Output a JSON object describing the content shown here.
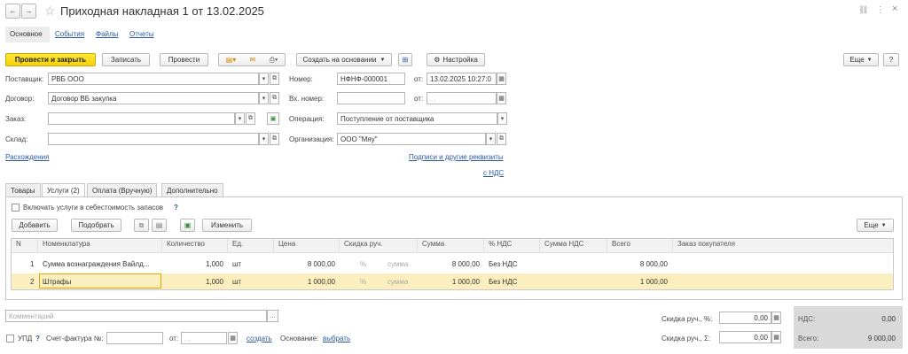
{
  "header": {
    "title": "Приходная накладная 1 от 13.02.2025",
    "back": "←",
    "forward": "→",
    "star": "☆",
    "link_icon": "🔗",
    "more": "⋮",
    "close": "×"
  },
  "nav": [
    "Основное",
    "События",
    "Файлы",
    "Отчеты"
  ],
  "toolbar": {
    "post_close": "Провести и закрыть",
    "save": "Записать",
    "post": "Провести",
    "create_based": "Создать на основании",
    "settings": "Настройка",
    "more": "Еще",
    "help": "?"
  },
  "form": {
    "supplier_label": "Поставщик:",
    "supplier": "РВБ ООО",
    "contract_label": "Договор:",
    "contract": "Договор ВБ закупка",
    "order_label": "Заказ:",
    "order": "",
    "warehouse_label": "Склад:",
    "warehouse": "",
    "number_label": "Номер:",
    "number": "НФНФ-000001",
    "from_label": "от:",
    "date": "13.02.2025 10:27:0",
    "in_number_label": "Вх. номер:",
    "in_number": "",
    "in_from_label": "от:",
    "in_date": " .  .",
    "operation_label": "Операция:",
    "operation": "Поступление от поставщика",
    "org_label": "Организация:",
    "org": "ООО \"Мяу\"",
    "discrepancies": "Расхождения",
    "signatures": "Подписи и другие реквизиты",
    "vat": "с НДС"
  },
  "tabs": [
    "Товары",
    "Услуги (2)",
    "Оплата (Вручную)",
    "Дополнительно"
  ],
  "services": {
    "include_cost_label": "Включать услуги в себестоимость запасов",
    "help": "?",
    "add": "Добавить",
    "pick": "Подобрать",
    "change": "Изменить",
    "more": "Еще",
    "columns": [
      "N",
      "Номенклатура",
      "Количество",
      "Ед.",
      "Цена",
      "Скидка руч.",
      "Сумма",
      "% НДС",
      "Сумма НДС",
      "Всего",
      "Заказ покупателя"
    ],
    "rows": [
      {
        "n": "1",
        "name": "Сумма вознаграждения Вайлд...",
        "qty": "1,000",
        "unit": "шт",
        "price": "8 000,00",
        "disc_pct": "%",
        "disc_sum": "сумма",
        "sum": "8 000,00",
        "vat_rate": "Без НДС",
        "vat_sum": "",
        "total": "8 000,00",
        "order": ""
      },
      {
        "n": "2",
        "name": "Штрафы",
        "qty": "1,000",
        "unit": "шт",
        "price": "1 000,00",
        "disc_pct": "%",
        "disc_sum": "сумма",
        "sum": "1 000,00",
        "vat_rate": "Без НДС",
        "vat_sum": "",
        "total": "1 000,00",
        "order": ""
      }
    ]
  },
  "footer": {
    "comment_placeholder": "Комментарий",
    "upd": "УПД",
    "help": "?",
    "invoice_label": "Счет-фактура №:",
    "from_label": "от:",
    "date_placeholder": " .  .",
    "create": "создать",
    "basis_label": "Основание:",
    "choose": "выбрать",
    "disc_pct_label": "Скидка руч., %:",
    "disc_pct": "0,00",
    "disc_sum_label": "Скидка руч., Σ:",
    "disc_sum": "0,00",
    "vat_label": "НДС:",
    "vat": "0,00",
    "total_label": "Всего:",
    "total": "9 000,00"
  }
}
